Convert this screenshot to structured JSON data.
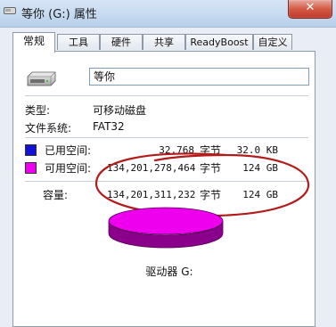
{
  "window": {
    "title": "等你 (G:) 属性",
    "close_glyph": "✕"
  },
  "tabs": [
    "常规",
    "工具",
    "硬件",
    "共享",
    "ReadyBoost",
    "自定义"
  ],
  "general": {
    "drive_name": "等你",
    "type_label": "类型:",
    "type_value": "可移动磁盘",
    "fs_label": "文件系统:",
    "fs_value": "FAT32",
    "used": {
      "label": "已用空间:",
      "bytes": "32,768",
      "bytes_unit": "字节",
      "size": "32.0 KB",
      "color": "#1212d6"
    },
    "free": {
      "label": "可用空间:",
      "bytes": "134,201,278,464",
      "bytes_unit": "字节",
      "size": "124 GB",
      "color": "#ee00ee"
    },
    "capacity": {
      "label": "容量:",
      "bytes": "134,201,311,232",
      "bytes_unit": "字节",
      "size": "124 GB"
    },
    "drive_caption": "驱动器 G:"
  },
  "colors": {
    "annotation": "#b31b1b",
    "pie_top": "#ee00ee",
    "pie_side": "#8a008a"
  }
}
